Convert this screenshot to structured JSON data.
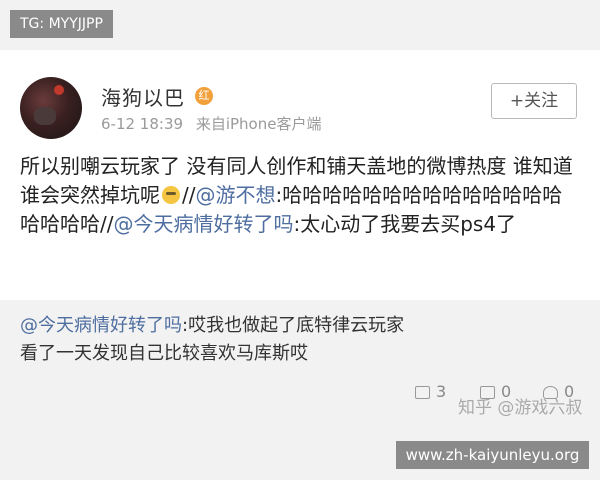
{
  "overlay": {
    "tg_label": "TG: MYYJJPP",
    "site_url": "www.zh-kaiyunleyu.org"
  },
  "post": {
    "author": "海狗以巴",
    "badge": "红",
    "time": "6-12 18:39",
    "source": "来自iPhone客户端",
    "follow_label": "+关注",
    "body_part1": "所以别嘲云玩家了 没有同人创作和铺天盖地的微博热度 谁知道谁会突然掉坑呢",
    "body_sep1": "//",
    "mention1": "@游不想",
    "body_part2": ":哈哈哈哈哈哈哈哈哈哈哈哈哈哈哈哈哈哈//",
    "mention2": "@今天病情好转了吗",
    "body_part3": ":太心动了我要去买ps4了"
  },
  "reply": {
    "mention": "@今天病情好转了吗",
    "text_line": ":哎我也做起了底特律云玩家",
    "text_line2": "看了一天发现自己比较喜欢马库斯哎"
  },
  "actions": {
    "repost_count": "3",
    "comment_count": "0",
    "like_count": "0"
  },
  "watermark": "知乎 @游戏六叔"
}
